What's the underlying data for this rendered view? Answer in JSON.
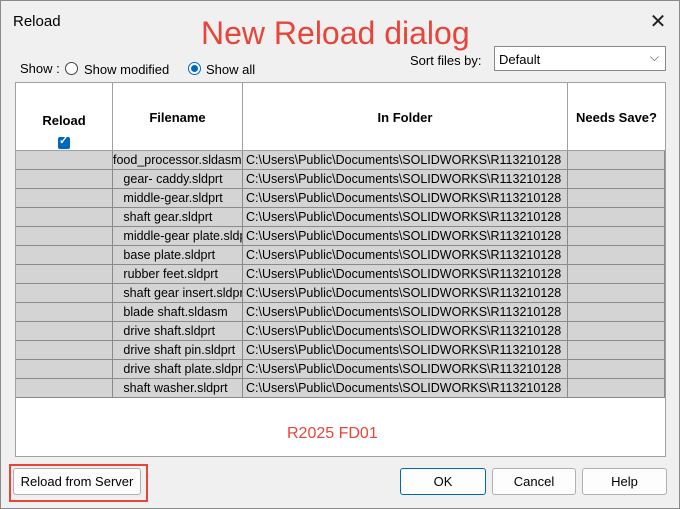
{
  "dialog": {
    "title": "Reload",
    "close_glyph": "✕"
  },
  "annotation": {
    "title": "New Reload dialog",
    "version": "R2025 FD01"
  },
  "show": {
    "label": "Show :",
    "options": [
      {
        "label": "Show modified",
        "selected": false
      },
      {
        "label": "Show all",
        "selected": true
      }
    ]
  },
  "sort": {
    "label": "Sort files by:",
    "value": "Default"
  },
  "table": {
    "headers": {
      "reload": "Reload",
      "filename": "Filename",
      "folder": "In Folder",
      "needs_save": "Needs Save?"
    },
    "reload_all_checked": true,
    "rows": [
      {
        "filename": "food_processor.sldasm",
        "folder": "C:\\Users\\Public\\Documents\\SOLIDWORKS\\R113210128"
      },
      {
        "filename": "   gear- caddy.sldprt",
        "folder": "C:\\Users\\Public\\Documents\\SOLIDWORKS\\R113210128"
      },
      {
        "filename": "   middle-gear.sldprt",
        "folder": "C:\\Users\\Public\\Documents\\SOLIDWORKS\\R113210128"
      },
      {
        "filename": "   shaft gear.sldprt",
        "folder": "C:\\Users\\Public\\Documents\\SOLIDWORKS\\R113210128"
      },
      {
        "filename": "   middle-gear plate.sldprt",
        "folder": "C:\\Users\\Public\\Documents\\SOLIDWORKS\\R113210128"
      },
      {
        "filename": "   base plate.sldprt",
        "folder": "C:\\Users\\Public\\Documents\\SOLIDWORKS\\R113210128"
      },
      {
        "filename": "   rubber feet.sldprt",
        "folder": "C:\\Users\\Public\\Documents\\SOLIDWORKS\\R113210128"
      },
      {
        "filename": "   shaft gear insert.sldprt",
        "folder": "C:\\Users\\Public\\Documents\\SOLIDWORKS\\R113210128"
      },
      {
        "filename": "   blade shaft.sldasm",
        "folder": "C:\\Users\\Public\\Documents\\SOLIDWORKS\\R113210128"
      },
      {
        "filename": "   drive shaft.sldprt",
        "folder": "C:\\Users\\Public\\Documents\\SOLIDWORKS\\R113210128"
      },
      {
        "filename": "   drive shaft pin.sldprt",
        "folder": "C:\\Users\\Public\\Documents\\SOLIDWORKS\\R113210128"
      },
      {
        "filename": "   drive shaft plate.sldprt",
        "folder": "C:\\Users\\Public\\Documents\\SOLIDWORKS\\R113210128"
      },
      {
        "filename": "   shaft washer.sldprt",
        "folder": "C:\\Users\\Public\\Documents\\SOLIDWORKS\\R113210128"
      }
    ]
  },
  "buttons": {
    "reload_server": "Reload from Server",
    "ok": "OK",
    "cancel": "Cancel",
    "help": "Help"
  },
  "colors": {
    "accent": "#0067c0",
    "annotation": "#e8443a",
    "row_bg": "#d4d4d4"
  }
}
